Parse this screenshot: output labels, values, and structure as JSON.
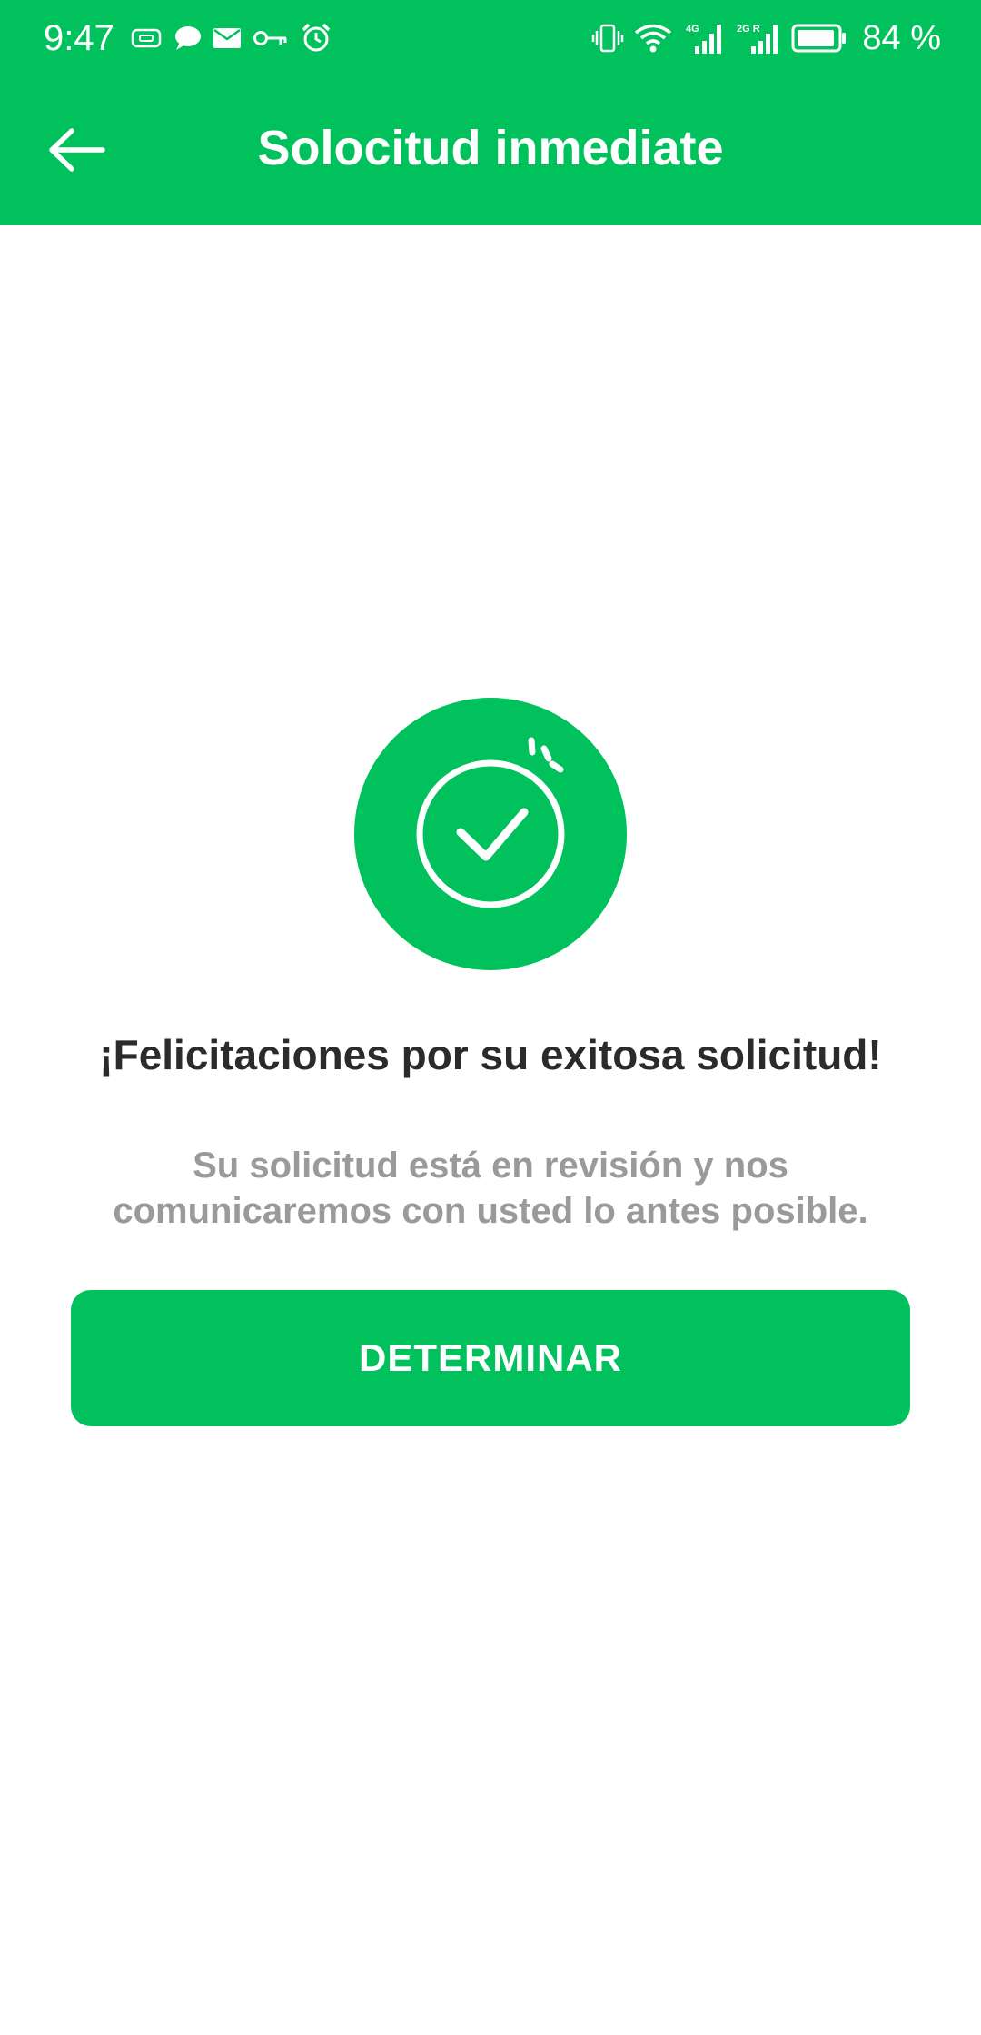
{
  "status_bar": {
    "time": "9:47",
    "battery_percent": "84 %",
    "network_labels": [
      "4G",
      "2G R"
    ],
    "icons": [
      "sim-card-icon",
      "chat-bubble-icon",
      "mail-icon",
      "vpn-key-icon",
      "alarm-icon",
      "vibrate-icon",
      "wifi-icon",
      "signal-icon",
      "signal-icon",
      "battery-icon"
    ]
  },
  "app_bar": {
    "title": "Solocitud inmediate",
    "back_icon": "arrow-left-icon"
  },
  "success": {
    "icon": "check-circle-icon",
    "headline": "¡Felicitaciones por su exitosa solicitud!",
    "message": "Su solicitud está en revisión y nos comunicaremos con usted lo antes posible."
  },
  "actions": {
    "primary_label": "DETERMINAR"
  },
  "colors": {
    "brand_green": "#00c15c",
    "headline_text": "#2b2b2b",
    "message_text": "#9a9a9a"
  }
}
